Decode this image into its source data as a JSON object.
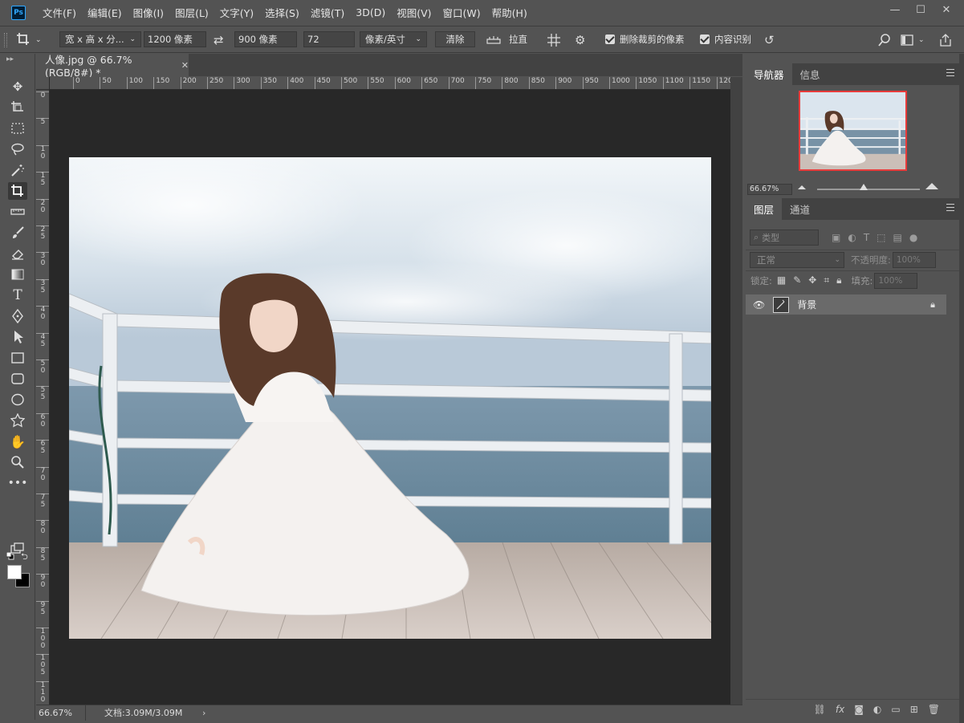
{
  "app": {
    "logo": "Ps"
  },
  "menu": [
    "文件(F)",
    "编辑(E)",
    "图像(I)",
    "图层(L)",
    "文字(Y)",
    "选择(S)",
    "滤镜(T)",
    "3D(D)",
    "视图(V)",
    "窗口(W)",
    "帮助(H)"
  ],
  "window_controls": {
    "minimize": "—",
    "maximize": "☐",
    "close": "✕"
  },
  "options": {
    "ratio_select": "宽 x 高 x 分...",
    "width_value": "1200 像素",
    "height_value": "900 像素",
    "resolution_value": "72",
    "unit_select": "像素/英寸",
    "clear_label": "清除",
    "straighten_label": "拉直",
    "delete_cropped_label": "删除裁剪的像素",
    "content_aware_label": "内容识别"
  },
  "document": {
    "tab_title": "人像.jpg @ 66.7%(RGB/8#) *",
    "zoom": "66.67%",
    "doc_info": "文档:3.09M/3.09M"
  },
  "rulers": {
    "h_ticks": [
      "0",
      "50",
      "100",
      "150",
      "200",
      "250",
      "300",
      "350",
      "400",
      "450",
      "500",
      "550",
      "600",
      "650",
      "700",
      "750",
      "800",
      "850",
      "900",
      "950",
      "1000",
      "1050",
      "1100",
      "1150",
      "1200"
    ],
    "v_ticks": [
      "0",
      "5",
      "1 0",
      "1 5",
      "2 0",
      "2 5",
      "3 0",
      "3 5",
      "4 0",
      "4 5",
      "5 0",
      "5 5",
      "6 0",
      "6 5",
      "7 0",
      "7 5",
      "8 0",
      "8 5",
      "9 0",
      "9 5",
      "1 0 0",
      "1 0 5",
      "1 1 0"
    ]
  },
  "navigator": {
    "tabs": [
      "导航器",
      "信息"
    ],
    "zoom": "66.67%",
    "zoom_fraction": 0.45
  },
  "layers": {
    "tabs": [
      "图层",
      "通道"
    ],
    "filter_label": "类型",
    "blend_mode": "正常",
    "opacity_label": "不透明度:",
    "opacity_value": "100%",
    "lock_label": "锁定:",
    "fill_label": "填充:",
    "fill_value": "100%",
    "items": [
      {
        "name": "背景",
        "visible": true,
        "locked": true
      }
    ]
  },
  "colors": {
    "accent": "#31a8ff",
    "nav_frame": "#e83b3b",
    "foreground": "#ffffff",
    "background": "#000000"
  }
}
